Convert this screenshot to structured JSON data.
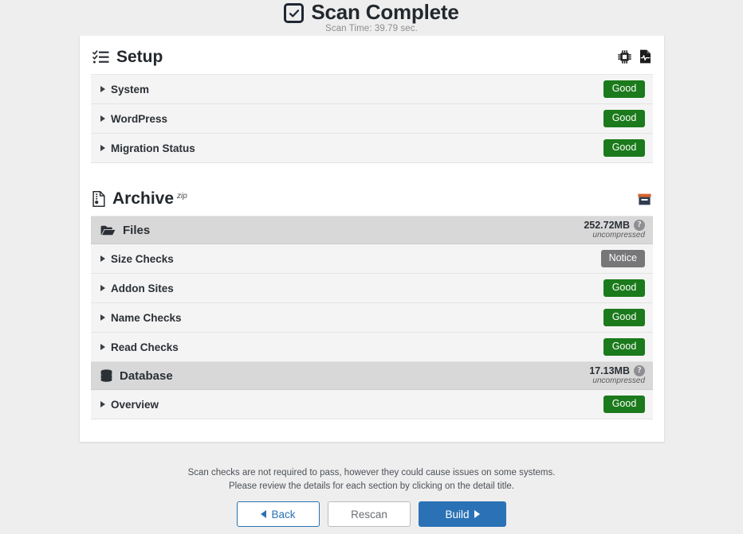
{
  "header": {
    "icon": "checkbox-checked-icon",
    "title": "Scan Complete",
    "scan_time": "Scan Time: 39.79 sec."
  },
  "setup": {
    "icon": "list-check-icon",
    "title": "Setup",
    "header_icons": [
      {
        "name": "microchip-icon"
      },
      {
        "name": "file-waveform-icon"
      }
    ],
    "rows": [
      {
        "label": "System",
        "badge": "Good",
        "badge_type": "good"
      },
      {
        "label": "WordPress",
        "badge": "Good",
        "badge_type": "good"
      },
      {
        "label": "Migration Status",
        "badge": "Good",
        "badge_type": "good"
      }
    ]
  },
  "archive": {
    "icon": "file-zipper-icon",
    "title": "Archive",
    "superscript": "zip",
    "header_icons": [
      {
        "name": "box-archive-icon"
      }
    ],
    "files_group": {
      "icon": "folder-open-icon",
      "label": "Files",
      "size": "252.72MB",
      "size_note": "uncompressed",
      "help": "?"
    },
    "files_rows": [
      {
        "label": "Size Checks",
        "badge": "Notice",
        "badge_type": "notice"
      },
      {
        "label": "Addon Sites",
        "badge": "Good",
        "badge_type": "good"
      },
      {
        "label": "Name Checks",
        "badge": "Good",
        "badge_type": "good"
      },
      {
        "label": "Read Checks",
        "badge": "Good",
        "badge_type": "good"
      }
    ],
    "database_group": {
      "icon": "database-icon",
      "label": "Database",
      "size": "17.13MB",
      "size_note": "uncompressed",
      "help": "?"
    },
    "database_rows": [
      {
        "label": "Overview",
        "badge": "Good",
        "badge_type": "good"
      }
    ]
  },
  "footer": {
    "note_line1": "Scan checks are not required to pass, however they could cause issues on some systems.",
    "note_line2": "Please review the details for each section by clicking on the detail title.",
    "buttons": {
      "back": "Back",
      "rescan": "Rescan",
      "build": "Build"
    }
  },
  "colors": {
    "good": "#1b7a1b",
    "notice": "#77777a",
    "primary": "#2a72b5",
    "page_bg": "#eeeeee"
  }
}
